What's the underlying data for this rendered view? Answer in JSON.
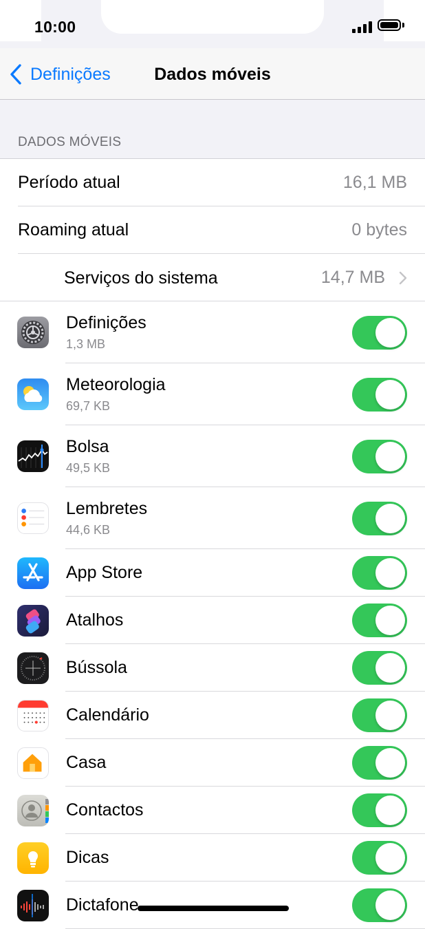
{
  "status_bar": {
    "time": "10:00"
  },
  "nav": {
    "back_label": "Definições",
    "title": "Dados móveis"
  },
  "section_header": "DADOS MÓVEIS",
  "summary": [
    {
      "label": "Período atual",
      "value": "16,1 MB"
    },
    {
      "label": "Roaming atual",
      "value": "0 bytes"
    },
    {
      "label": "Serviços do sistema",
      "value": "14,7 MB"
    }
  ],
  "apps": [
    {
      "name": "Definições",
      "usage": "1,3 MB",
      "icon": "settings-icon",
      "enabled": true
    },
    {
      "name": "Meteorologia",
      "usage": "69,7 KB",
      "icon": "weather-icon",
      "enabled": true
    },
    {
      "name": "Bolsa",
      "usage": "49,5 KB",
      "icon": "stocks-icon",
      "enabled": true
    },
    {
      "name": "Lembretes",
      "usage": "44,6 KB",
      "icon": "reminders-icon",
      "enabled": true
    },
    {
      "name": "App Store",
      "usage": "",
      "icon": "app-store-icon",
      "enabled": true
    },
    {
      "name": "Atalhos",
      "usage": "",
      "icon": "shortcuts-icon",
      "enabled": true
    },
    {
      "name": "Bússola",
      "usage": "",
      "icon": "compass-icon",
      "enabled": true
    },
    {
      "name": "Calendário",
      "usage": "",
      "icon": "calendar-icon",
      "enabled": true
    },
    {
      "name": "Casa",
      "usage": "",
      "icon": "home-icon",
      "enabled": true
    },
    {
      "name": "Contactos",
      "usage": "",
      "icon": "contacts-icon",
      "enabled": true
    },
    {
      "name": "Dicas",
      "usage": "",
      "icon": "tips-icon",
      "enabled": true
    },
    {
      "name": "Dictafone",
      "usage": "",
      "icon": "voice-memos-icon",
      "enabled": true
    }
  ],
  "colors": {
    "accent": "#0a7aff",
    "toggle_on": "#34c759",
    "secondary_text": "#8a8a8e"
  }
}
